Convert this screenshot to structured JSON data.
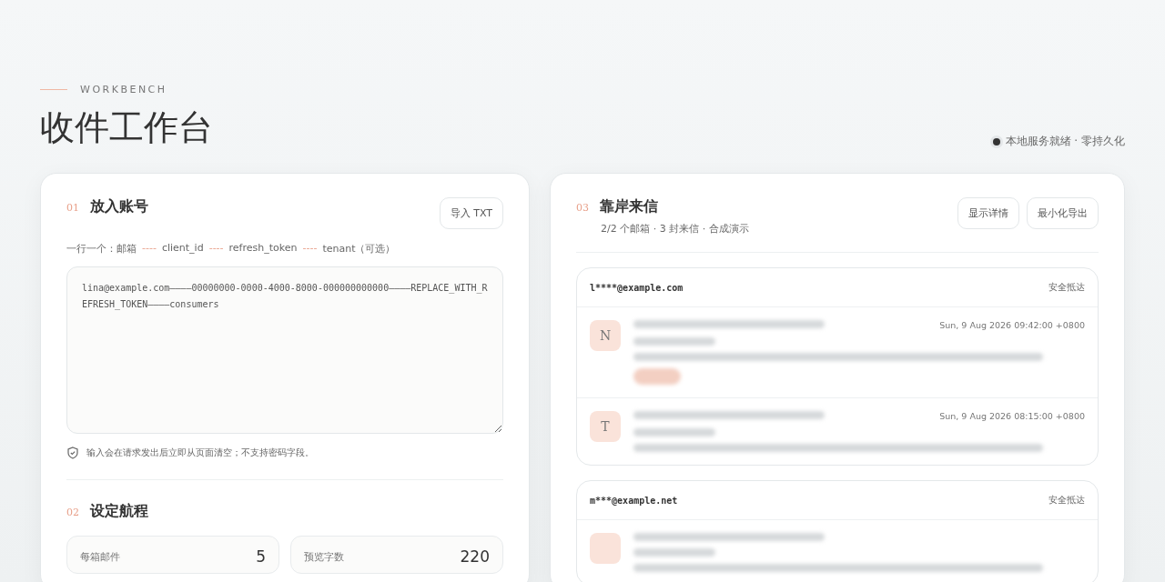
{
  "header": {
    "eyebrow": "WORKBENCH",
    "title": "收件工作台",
    "status": "本地服务就绪 · 零持久化"
  },
  "accounts": {
    "step": "01",
    "title": "放入账号",
    "import_button": "导入 TXT",
    "format_parts": [
      {
        "kind": "text",
        "text": "一行一个：邮箱"
      },
      {
        "kind": "sep",
        "text": "----"
      },
      {
        "kind": "text",
        "text": "client_id"
      },
      {
        "kind": "sep",
        "text": "----"
      },
      {
        "kind": "text",
        "text": "refresh_token"
      },
      {
        "kind": "sep",
        "text": "----"
      },
      {
        "kind": "text",
        "text": "tenant（可选）"
      }
    ],
    "value": "lina@example.com————00000000-0000-4000-8000-000000000000————REPLACE_WITH_REFRESH_TOKEN————consumers",
    "notice": "输入会在请求发出后立即从页面清空；不支持密码字段。"
  },
  "route": {
    "step": "02",
    "title": "设定航程",
    "fields": [
      {
        "label": "每箱邮件",
        "value": "5"
      },
      {
        "label": "预览字数",
        "value": "220"
      }
    ]
  },
  "inbox": {
    "step": "03",
    "title": "靠岸来信",
    "summary": "2/2 个邮箱 · 3 封来信 · 合成演示",
    "buttons": [
      "显示详情",
      "最小化导出"
    ],
    "mailboxes": [
      {
        "address": "l****@example.com",
        "status": "安全抵达",
        "messages": [
          {
            "initial": "N",
            "time": "Sun, 9 Aug 2026 09:42:00 +0800",
            "tag": true
          },
          {
            "initial": "T",
            "time": "Sun, 9 Aug 2026 08:15:00 +0800",
            "tag": false
          }
        ]
      },
      {
        "address": "m***@example.net",
        "status": "安全抵达",
        "messages": [
          {
            "tag": false
          }
        ]
      }
    ]
  }
}
